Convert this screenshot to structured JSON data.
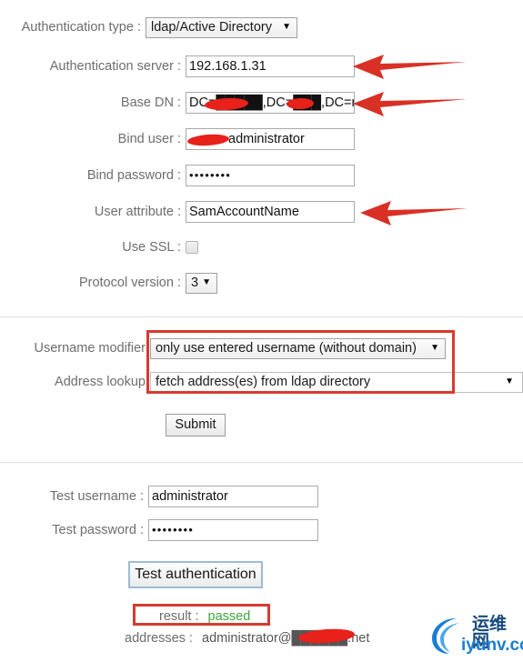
{
  "form": {
    "auth_type": {
      "label": "Authentication type :",
      "value": "ldap/Active Directory",
      "caret": "▼"
    },
    "auth_server": {
      "label": "Authentication server :",
      "value": "192.168.1.31"
    },
    "base_dn": {
      "label": "Base DN :",
      "value": "DC=█████,DC=███,DC=ne"
    },
    "bind_user": {
      "label": "Bind user :",
      "value": "administrator"
    },
    "bind_password": {
      "label": "Bind password :",
      "value": "••••••••"
    },
    "user_attribute": {
      "label": "User attribute :",
      "value": "SamAccountName"
    },
    "use_ssl": {
      "label": "Use SSL :",
      "checked": false
    },
    "protocol_version": {
      "label": "Protocol version :",
      "value": "3",
      "caret": "▼"
    },
    "username_modifier": {
      "label": "Username modifier",
      "value": "only use entered username (without domain)",
      "caret": "▼"
    },
    "address_lookup": {
      "label": "Address lookup",
      "value": "fetch address(es) from ldap directory",
      "caret": "▼"
    },
    "submit_label": "Submit"
  },
  "test": {
    "username": {
      "label": "Test username :",
      "value": "administrator"
    },
    "password": {
      "label": "Test password :",
      "value": "••••••••"
    },
    "button_label": "Test authentication",
    "result": {
      "label": "result :",
      "value": "passed"
    },
    "addresses": {
      "label": "addresses :",
      "value": "administrator@██████.net"
    }
  },
  "logo": {
    "cn": "运维网",
    "en": "iyunv.com"
  },
  "colors": {
    "annotation_red": "#d63a2f",
    "arrow_red": "#d93025",
    "success_green": "#3aa83a",
    "logo_blue": "#1a7fd4",
    "logo_dark_blue": "#16497e",
    "label_gray": "#6d6d6d"
  }
}
